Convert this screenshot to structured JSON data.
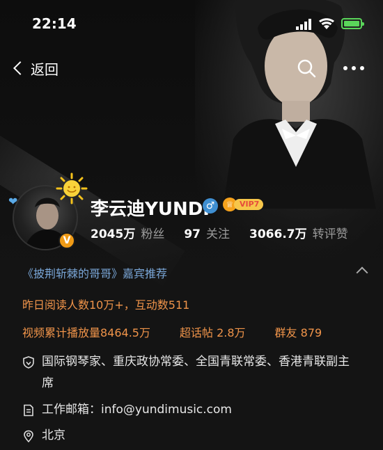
{
  "status_bar": {
    "time": "22:14"
  },
  "nav": {
    "back_label": "返回"
  },
  "profile": {
    "name": "李云迪YUNDI",
    "vip_level": "VIP7",
    "verified_mark": "V",
    "stats": [
      {
        "value": "2045万",
        "label": "粉丝"
      },
      {
        "value": "97",
        "label": "关注"
      },
      {
        "value": "3066.7万",
        "label": "转评赞"
      }
    ]
  },
  "recommend": "《披荆斩棘的哥哥》嘉宾推荐",
  "activity": {
    "read_stats": "昨日阅读人数10万+，互动数511",
    "video_plays": "视频累计播放量8464.5万",
    "super_topic": "超话帖 2.8万",
    "fan_group": "群友 879"
  },
  "details": {
    "verification": "国际钢琴家、重庆政协常委、全国青联常委、香港青联副主席",
    "email": "工作邮箱：info@yundimusic.com",
    "location": "北京"
  },
  "colors": {
    "accent_orange": "#f0944a",
    "link_blue": "#7aa7d8",
    "battery_green": "#5ad65a",
    "vip_gold": "#f7c64a"
  },
  "icons": [
    "signal-icon",
    "wifi-icon",
    "battery-icon",
    "back-chevron-icon",
    "search-icon",
    "more-icon",
    "shield-icon",
    "document-icon",
    "location-pin-icon",
    "gender-male-icon",
    "vip-crown-icon",
    "sun-badge-icon",
    "heart-icon"
  ]
}
